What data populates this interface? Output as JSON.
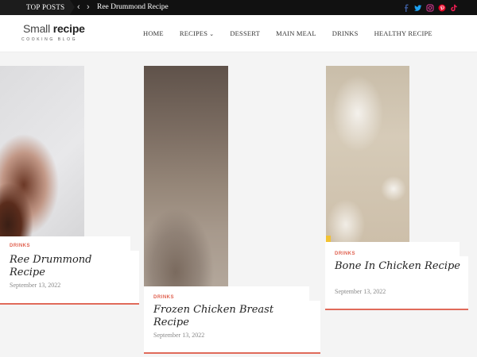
{
  "topbar": {
    "label": "TOP POSTS",
    "prev_icon": "chevron-left",
    "next_icon": "chevron-right",
    "current_post": "Ree Drummond Recipe",
    "social": [
      "facebook-icon",
      "twitter-icon",
      "instagram-icon",
      "pinterest-icon",
      "tiktok-icon"
    ],
    "social_colors": {
      "facebook": "#3b5998",
      "twitter": "#1da1f2",
      "instagram": "#c13584",
      "pinterest": "#e60023",
      "tiktok": "#ee1d52"
    }
  },
  "header": {
    "logo_light": "Small",
    "logo_bold": "recipe",
    "logo_sub": "COOKING BLOG",
    "menu": [
      "HOME",
      "RECIPES",
      "DESSERT",
      "MAIN MEAL",
      "DRINKS",
      "HEALTHY RECIPE"
    ]
  },
  "cards": [
    {
      "category": "DRINKS",
      "title": "Ree Drummond Recipe",
      "date": "September 13, 2022"
    },
    {
      "category": "DRINKS",
      "title": "Frozen Chicken Breast Recipe",
      "date": "September 13, 2022"
    },
    {
      "category": "DRINKS",
      "title": "Bone In Chicken Recipe",
      "date": "September 13, 2022"
    }
  ],
  "colors": {
    "accent": "#e0604e",
    "topbar_bg": "#111111",
    "page_bg": "#f4f4f4"
  }
}
